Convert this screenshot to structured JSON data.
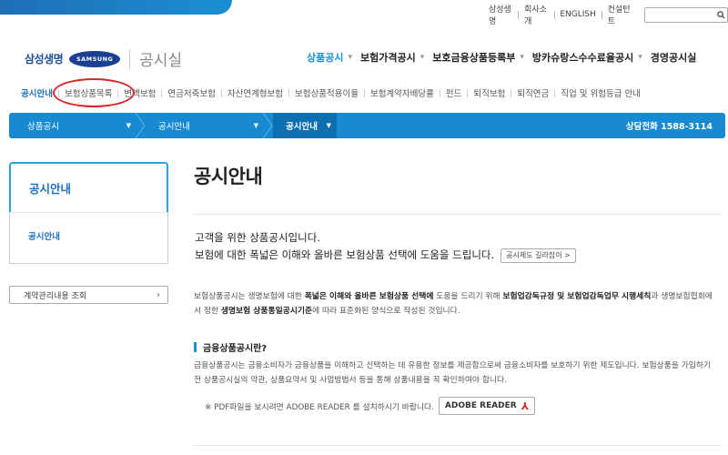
{
  "utility": {
    "links": [
      "삼성생명",
      "회사소개",
      "ENGLISH",
      "컨설턴트"
    ],
    "search_placeholder": "",
    "search_icon": "search-icon"
  },
  "brand": {
    "name": "삼성생명",
    "samsung": "SAMSUNG",
    "section": "공시실"
  },
  "gnb": {
    "items": [
      {
        "label": "상품공시"
      },
      {
        "label": "보험가격공시"
      },
      {
        "label": "보호금융상품등록부"
      },
      {
        "label": "방카슈랑스수수료율공시"
      },
      {
        "label": "경영공시실"
      }
    ]
  },
  "subnav": {
    "items": [
      "공시안내",
      "보험상품목록",
      "변액보험",
      "연금저축보험",
      "자산연계형보험",
      "보험상품적용이율",
      "보험계약자배당률",
      "펀드",
      "퇴직보험",
      "퇴직연금",
      "직업 및 위험등급 안내"
    ]
  },
  "location": {
    "crumbs": [
      "상품공시",
      "공시안내",
      "공시안내"
    ],
    "phone": "상담전화  1588-3114"
  },
  "lnb": {
    "title": "공시안내",
    "sub": "공시안내",
    "contract_btn": "계약관리내용 조회"
  },
  "main": {
    "title": "공시안내",
    "intro_line1": "고객을 위한 상품공시입니다.",
    "intro_line2": "보험에 대한 폭넓은 이해와 올바른 보험상품 선택에 도움을 드립니다.",
    "guide_btn": "공시제도 길라잡이 >",
    "para1": {
      "t1": "보험상품공시는 생명보험에 대한 ",
      "b1": "폭넓은 이해와 올바른 보험상품 선택에",
      "t2": " 도움을 드리기 위해 ",
      "b2": "보험업감독규정 및 보험업감독업무 시행세칙",
      "t3": "과 생명보험협회에서 정한 ",
      "b3": "생명보험 상품통일공시기준",
      "t4": "에 따라 표준화된 양식으로 작성된 것입니다."
    },
    "sub_head": "금융상품공시란?",
    "para2": "금융상품공시는 금융소비자가 금융상품을 이해하고 선택하는 데 유용한 정보를 제공함으로써 금융소비자를 보호하기 위한 제도입니다. 보험상품을 가입하기 전 상품공시실의 약관, 상품요약서 및 사업방법서 등을 통해 상품내용을 꼭 확인하여야 합니다.",
    "pdf_note": "※ PDF파일을 보시려면 ADOBE READER 를 설치하시기 바랍니다.",
    "reader_btn": "ADOBE READER"
  },
  "colors": {
    "accent": "#1a8fd3",
    "bar": "#178ad2",
    "highlight_circle": "#d9262b"
  }
}
